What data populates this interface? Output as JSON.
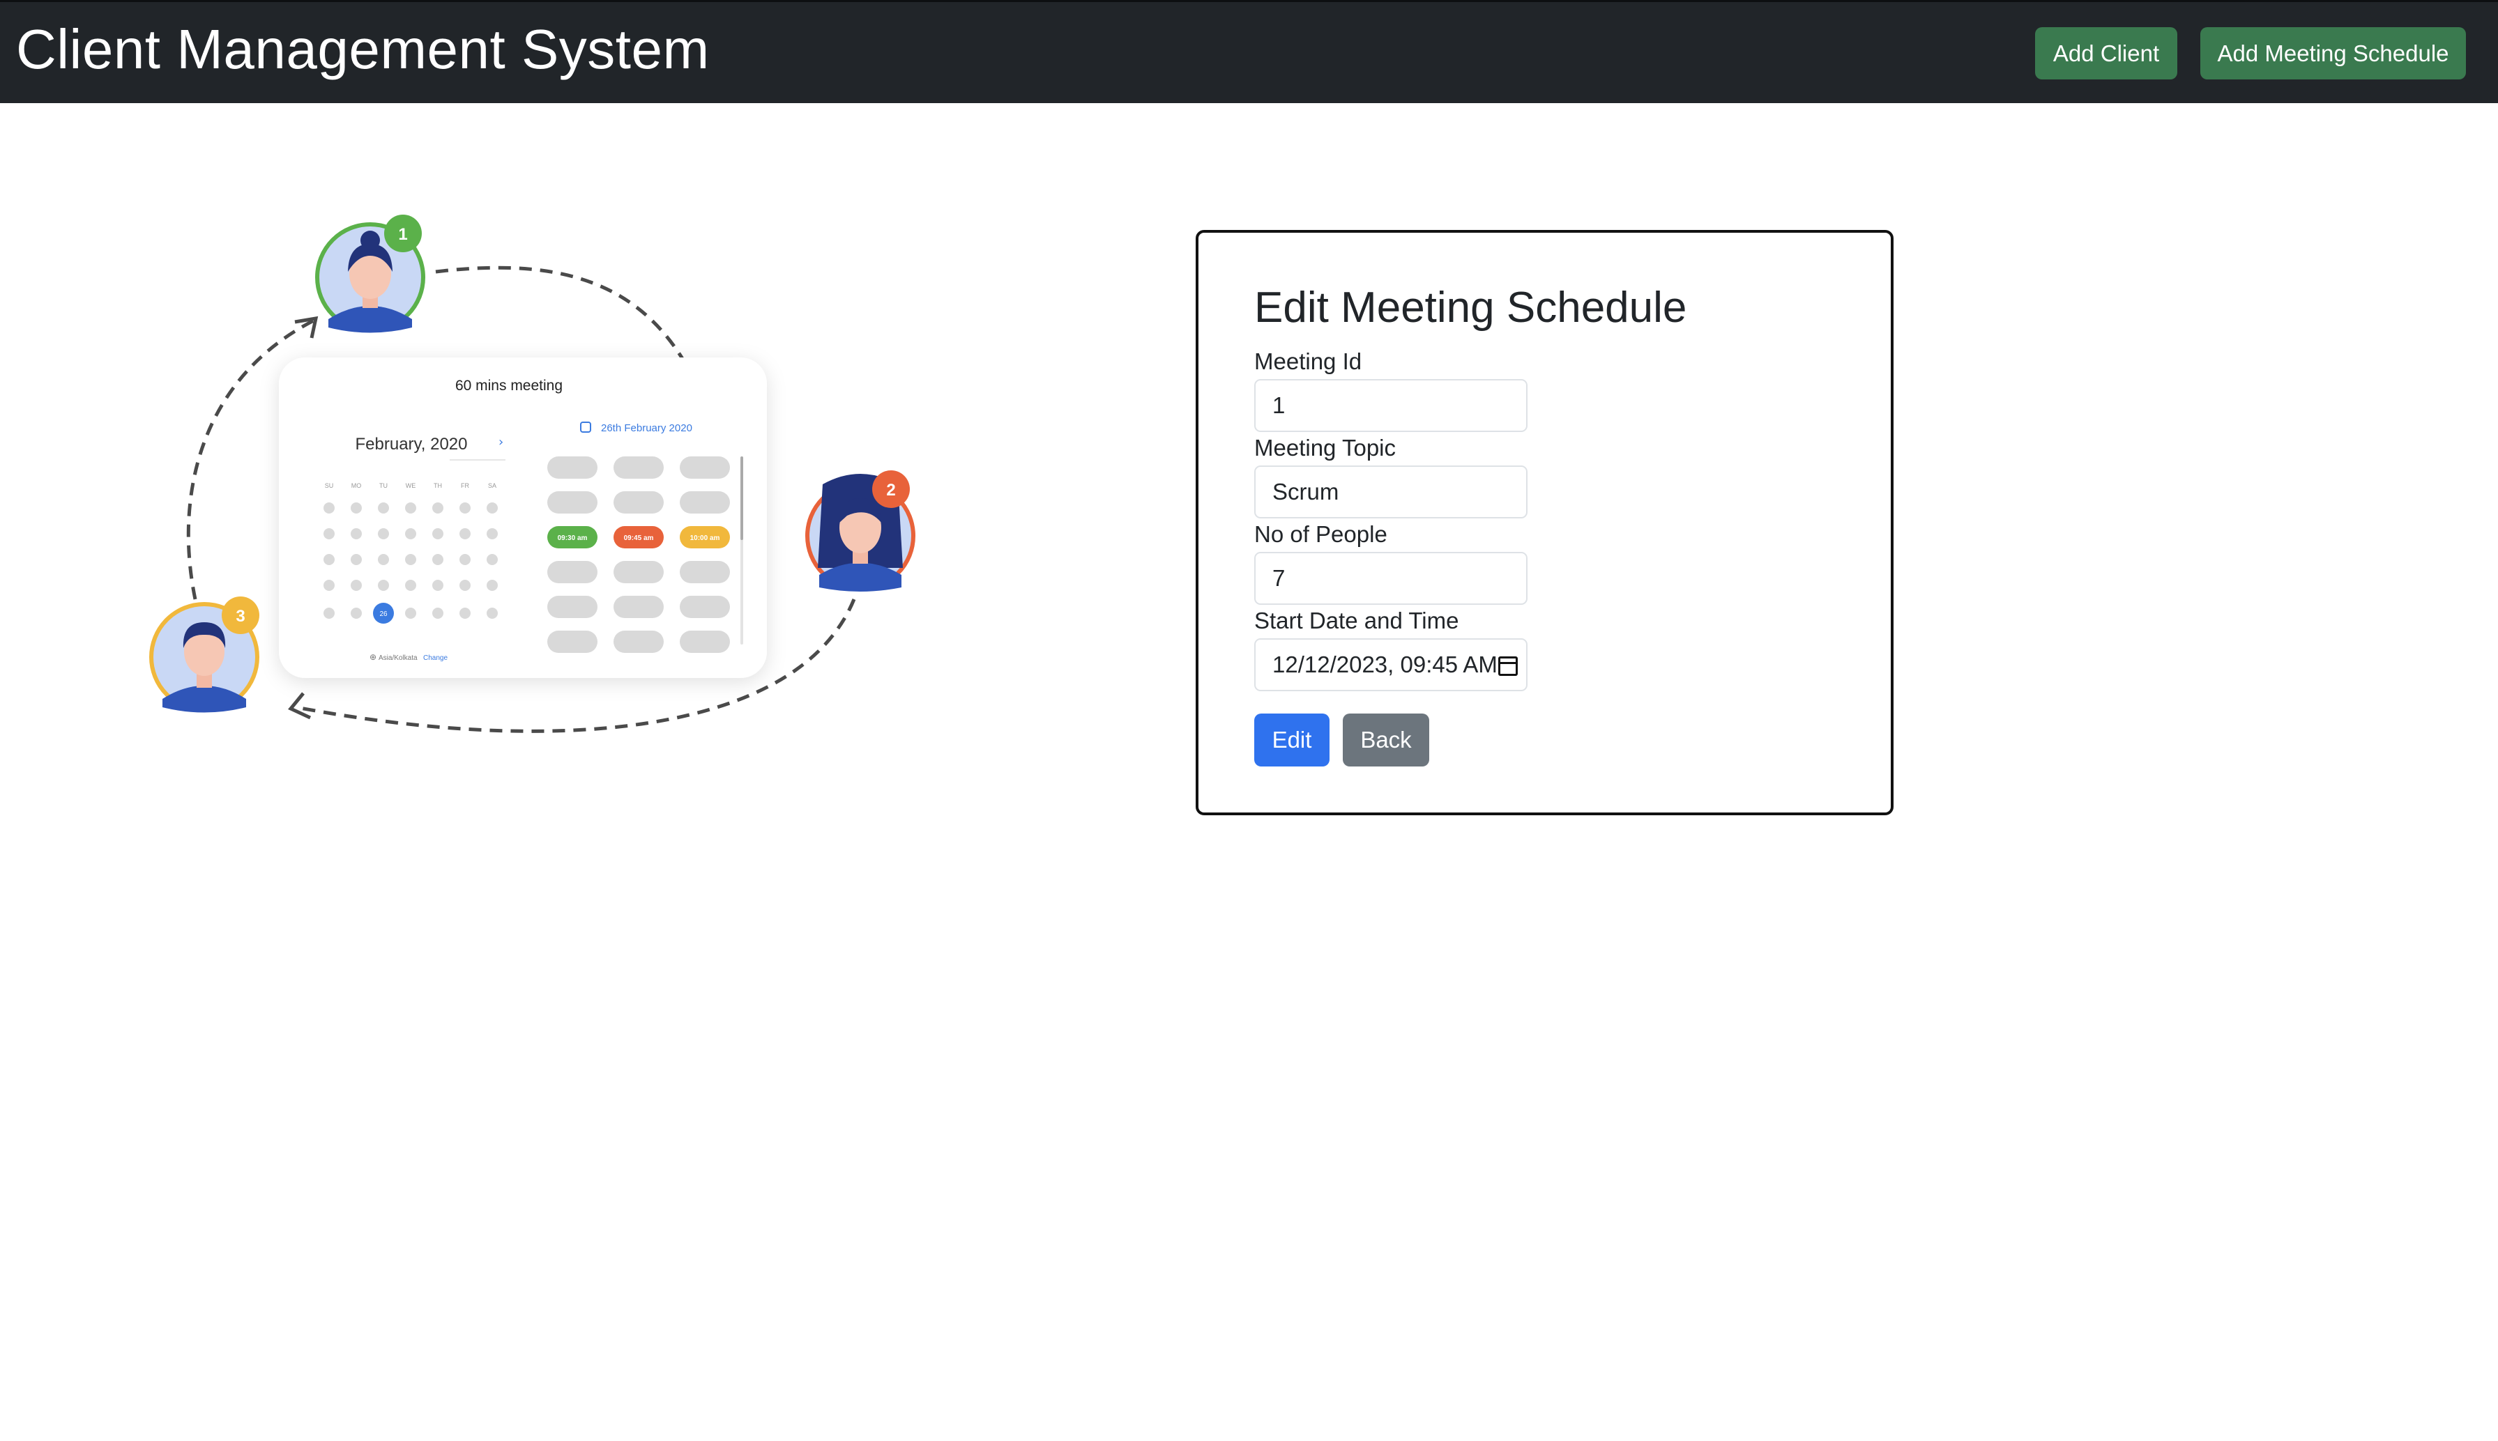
{
  "navbar": {
    "brand": "Client Management System",
    "add_client_label": "Add Client",
    "add_meeting_label": "Add Meeting Schedule",
    "bg_color": "#212529",
    "button_color": "#3a7a4f"
  },
  "illustration": {
    "meeting_title": "60 mins meeting",
    "month_label": "February, 2020",
    "selected_date_label": "26th February 2020",
    "weekday_labels": [
      "SU",
      "MO",
      "TU",
      "WE",
      "TH",
      "FR",
      "SA"
    ],
    "selected_day": "26",
    "time_slots": [
      "09:30 am",
      "09:45 am",
      "10:00 am"
    ],
    "timezone_label": "Asia/Kolkata",
    "timezone_change": "Change",
    "avatar_badges": [
      "1",
      "2",
      "3"
    ],
    "avatar_colors": [
      "#5bb14a",
      "#e8623a",
      "#f1b83c"
    ]
  },
  "form": {
    "title": "Edit Meeting Schedule",
    "meeting_id": {
      "label": "Meeting Id",
      "value": "1"
    },
    "meeting_topic": {
      "label": "Meeting Topic",
      "value": "Scrum"
    },
    "no_of_people": {
      "label": "No of People",
      "value": "7"
    },
    "start_datetime": {
      "label": "Start Date and Time",
      "value": "12/12/2023, 09:45 AM"
    },
    "edit_label": "Edit",
    "back_label": "Back"
  }
}
